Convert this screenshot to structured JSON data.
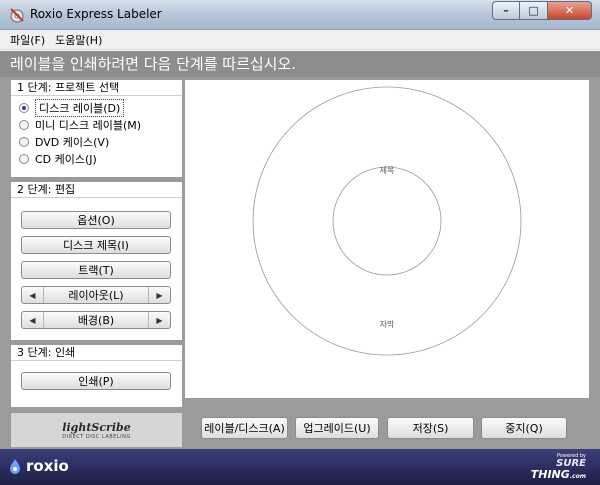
{
  "window": {
    "title": "Roxio Express Labeler",
    "min": "–",
    "max": "□",
    "close": "✕"
  },
  "menu": [
    "파일(F)",
    "도움말(H)"
  ],
  "banner": "레이블을 인쇄하려면 다음 단계를 따르십시오.",
  "step1": {
    "title": "1 단계: 프로젝트 선택",
    "options": [
      {
        "label": "디스크 레이블(D)",
        "selected": true
      },
      {
        "label": "미니 디스크 레이블(M)",
        "selected": false
      },
      {
        "label": "DVD 케이스(V)",
        "selected": false
      },
      {
        "label": "CD 케이스(J)",
        "selected": false
      }
    ]
  },
  "step2": {
    "title": "2 단계: 편집",
    "options_btn": "옵션(O)",
    "disc_title_btn": "디스크 제목(I)",
    "tracks_btn": "트랙(T)",
    "layout_label": "레이아웃(L)",
    "background_label": "배경(B)",
    "arrow_left": "◀",
    "arrow_right": "▶"
  },
  "step3": {
    "title": "3 단계: 인쇄",
    "print_btn": "인쇄(P)"
  },
  "lightscribe": {
    "logo": "lightScribe",
    "tagline": "DIRECT DISC LABELING"
  },
  "disc": {
    "title": "제목",
    "subtitle": "자막"
  },
  "bottom": {
    "label_disc": "레이블/디스크(A)",
    "upgrade": "업그레이드(U)",
    "save": "저장(S)",
    "stop": "중지(Q)"
  },
  "footer": {
    "brand": "roxio",
    "powered": "Powered by",
    "sure": "SURE",
    "thing": "THING",
    "com": ".com"
  }
}
